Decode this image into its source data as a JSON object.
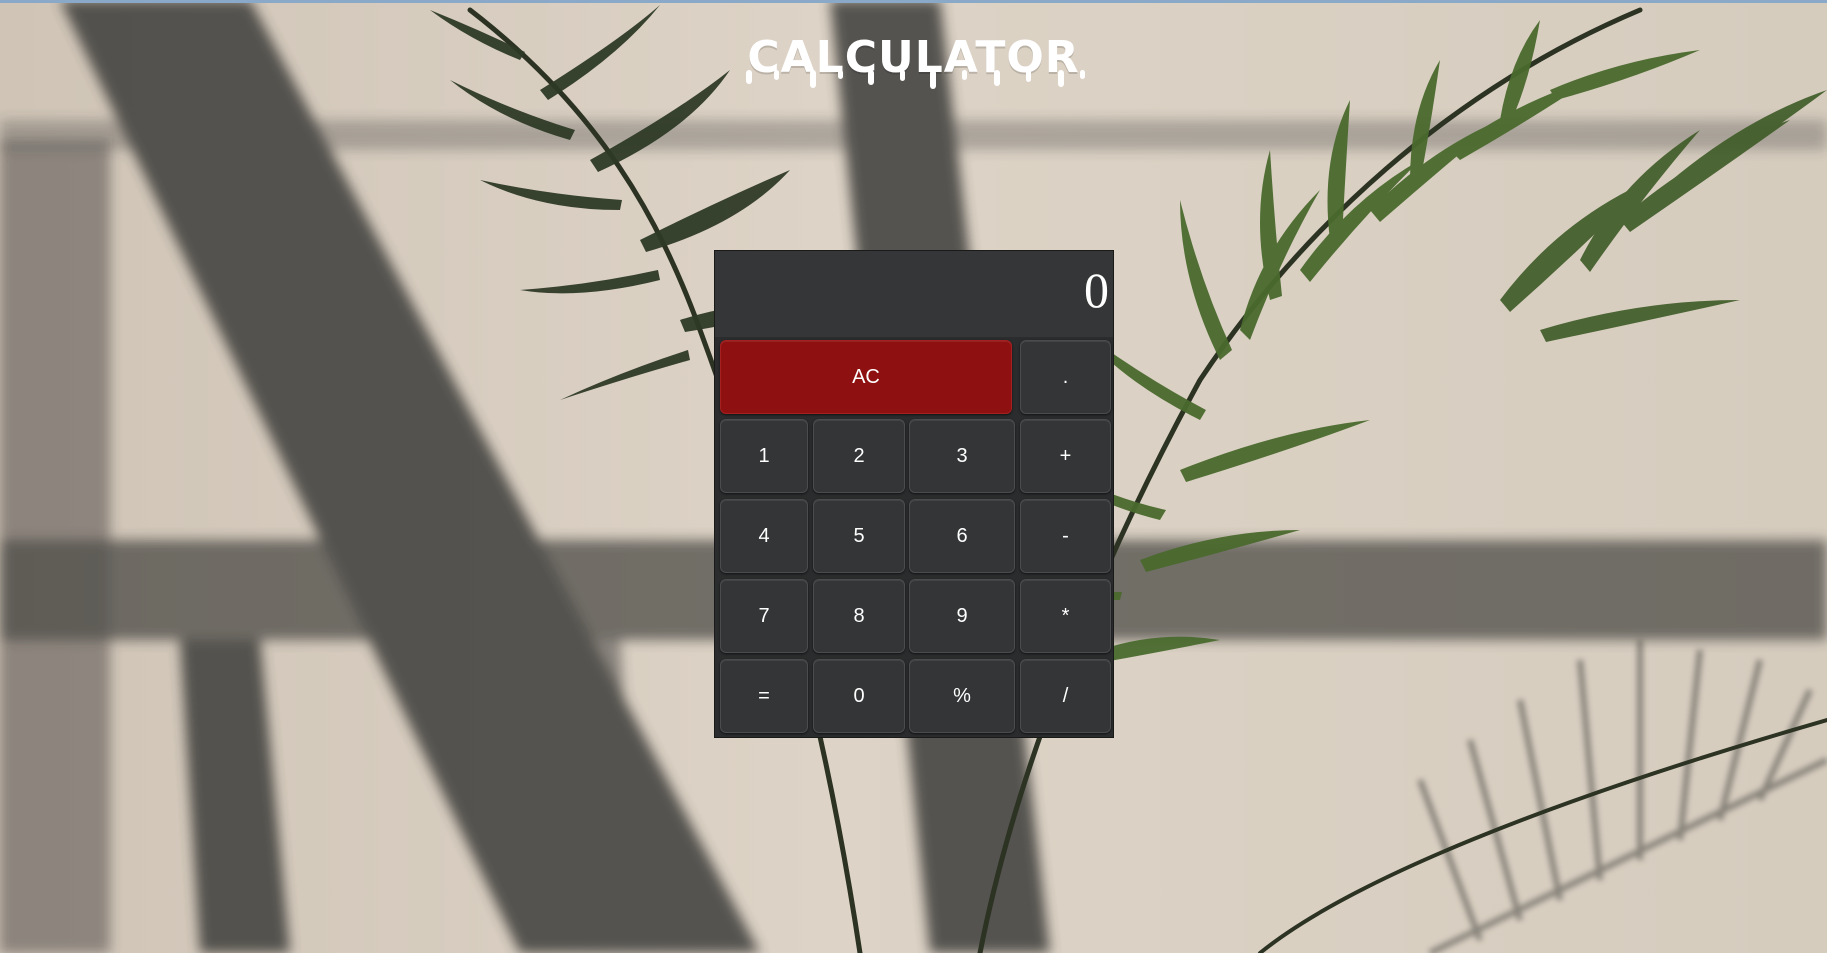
{
  "page": {
    "title": "CALCULATOR"
  },
  "calculator": {
    "display_value": "0",
    "keys": {
      "clear": "AC",
      "decimal": ".",
      "one": "1",
      "two": "2",
      "three": "3",
      "plus": "+",
      "four": "4",
      "five": "5",
      "six": "6",
      "minus": "-",
      "seven": "7",
      "eight": "8",
      "nine": "9",
      "multiply": "*",
      "equals": "=",
      "zero": "0",
      "percent": "%",
      "divide": "/"
    }
  },
  "colors": {
    "calculator_body": "#2b2c2d",
    "display": "#343637",
    "key": "#333536",
    "clear_key": "#8e1010",
    "wall": "#d8cfc2"
  }
}
